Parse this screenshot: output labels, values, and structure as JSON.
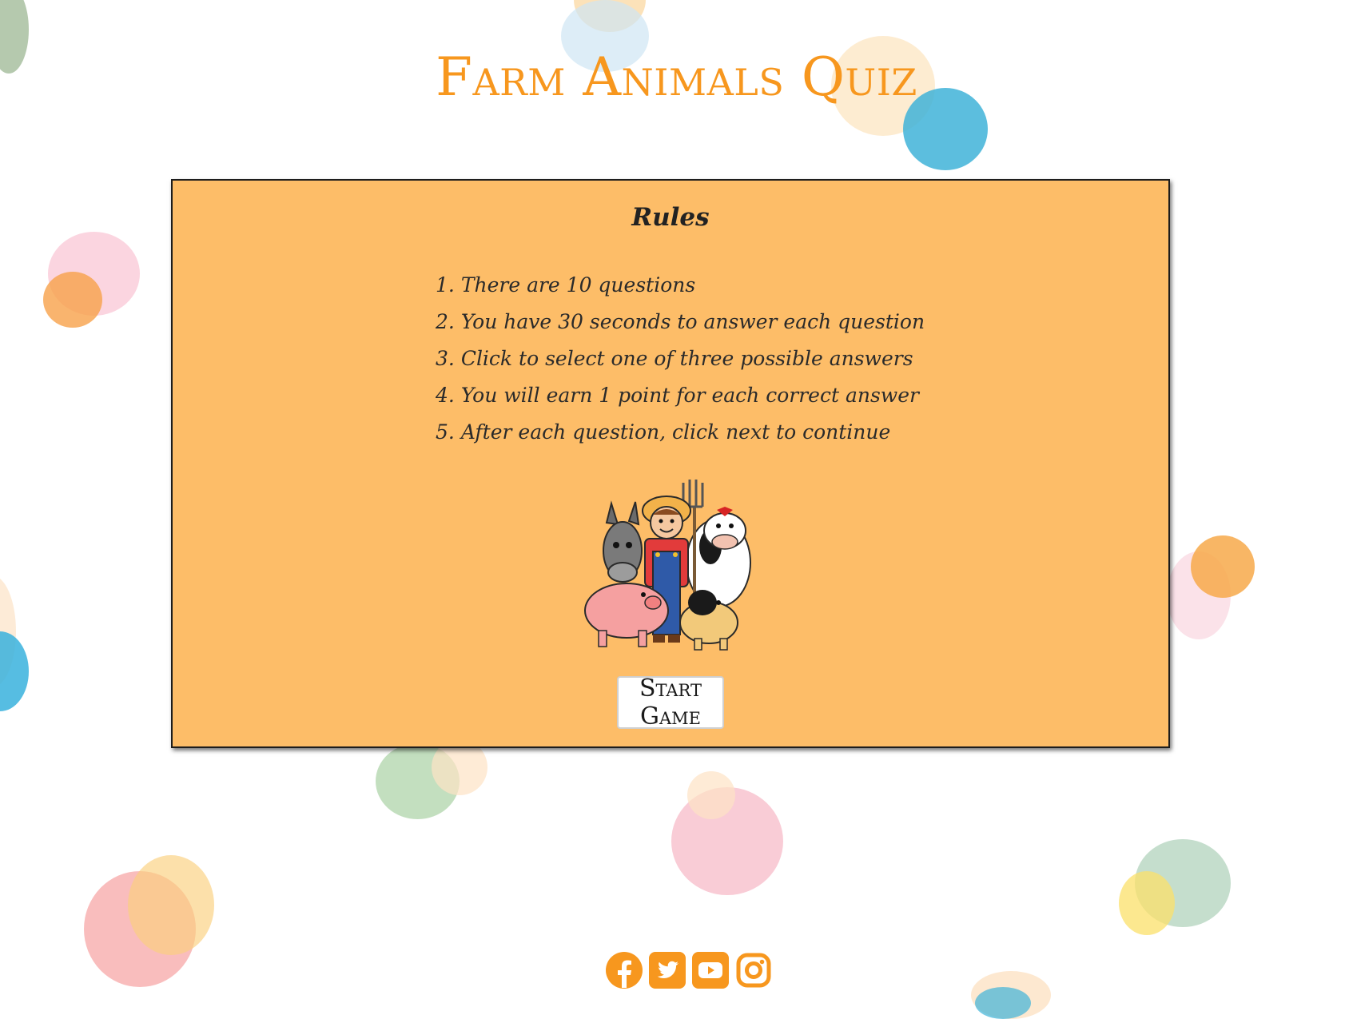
{
  "header": {
    "title": "Farm Animals Quiz"
  },
  "rules": {
    "heading": "Rules",
    "items": [
      {
        "num": "1.",
        "text": "There are 10 questions"
      },
      {
        "num": "2.",
        "text": "You have 30 seconds to answer each question"
      },
      {
        "num": "3.",
        "text": "Click to select one of three possible answers"
      },
      {
        "num": "4.",
        "text": "You will earn 1 point for each correct answer"
      },
      {
        "num": "5.",
        "text": "After each question, click next to continue"
      }
    ],
    "start_label": "Start Game"
  },
  "footer": {
    "social": [
      "facebook-icon",
      "twitter-icon",
      "youtube-icon",
      "instagram-icon"
    ]
  },
  "colors": {
    "accent": "#f7971e",
    "card_background": "#fdbd68"
  }
}
